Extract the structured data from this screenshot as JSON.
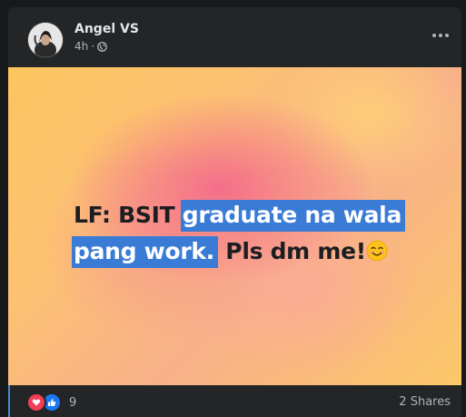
{
  "post": {
    "author": "Angel VS",
    "time": "4h",
    "separator": "·",
    "text_part1": "LF: BSIT ",
    "text_highlight1": "graduate na wala",
    "text_highlight2": "pang work.",
    "text_part2": " Pls dm me!",
    "emoji": "smiling-face-emoji"
  },
  "footer": {
    "reaction_count": "9",
    "shares": "2 Shares"
  },
  "colors": {
    "page_bg": "#18191a",
    "card_bg": "#242526",
    "highlight": "#3a7bd5",
    "love": "#f33e58",
    "like": "#1877f2"
  }
}
